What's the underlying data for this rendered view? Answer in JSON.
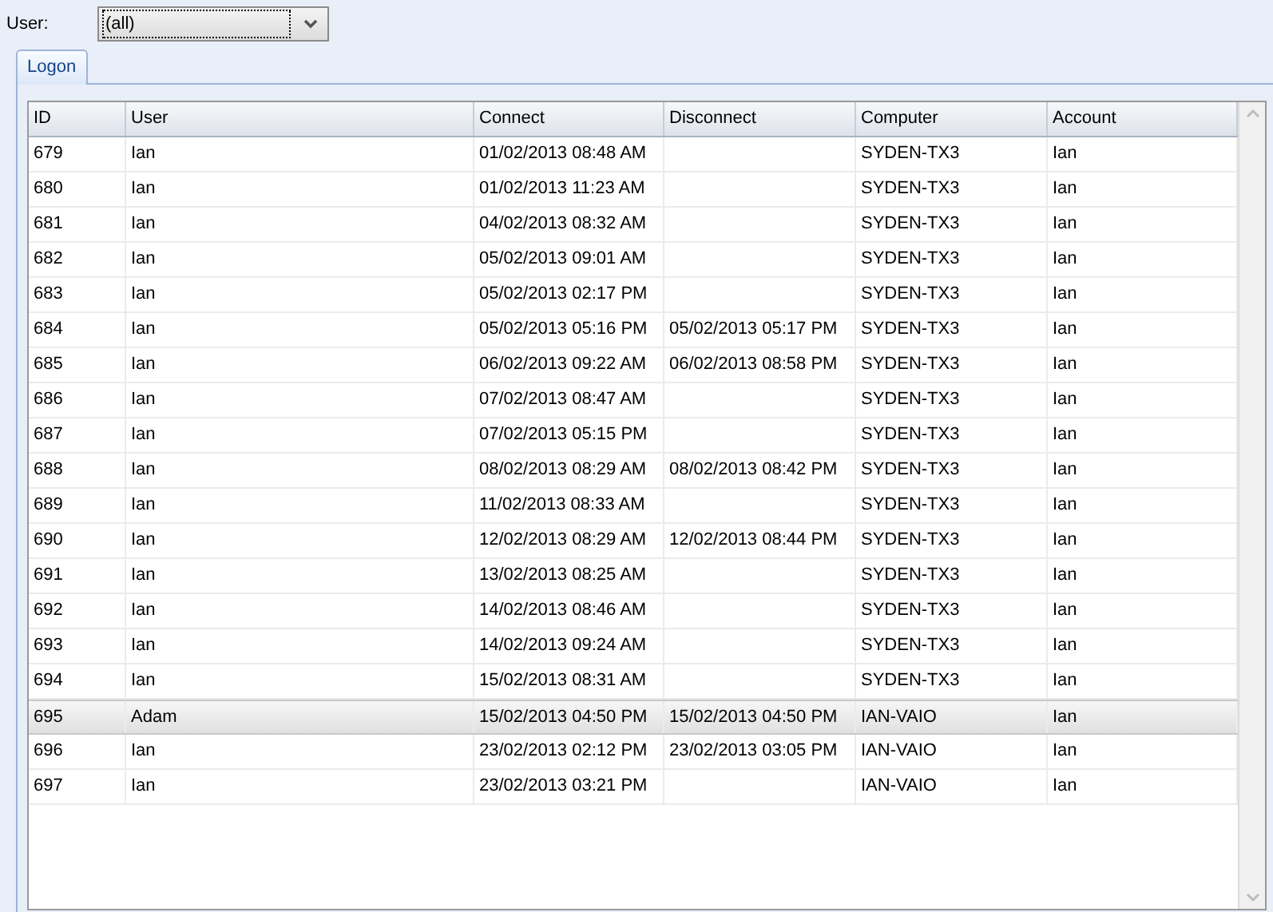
{
  "filter": {
    "label": "User:",
    "value": "(all)"
  },
  "tabs": [
    {
      "label": "Logon",
      "selected": true
    }
  ],
  "table": {
    "columns": [
      "ID",
      "User",
      "Connect",
      "Disconnect",
      "Computer",
      "Account"
    ],
    "rows": [
      {
        "cells": [
          "679",
          "Ian",
          "01/02/2013 08:48 AM",
          "",
          "SYDEN-TX3",
          "Ian"
        ],
        "selected": false
      },
      {
        "cells": [
          "680",
          "Ian",
          "01/02/2013 11:23 AM",
          "",
          "SYDEN-TX3",
          "Ian"
        ],
        "selected": false
      },
      {
        "cells": [
          "681",
          "Ian",
          "04/02/2013 08:32 AM",
          "",
          "SYDEN-TX3",
          "Ian"
        ],
        "selected": false
      },
      {
        "cells": [
          "682",
          "Ian",
          "05/02/2013 09:01 AM",
          "",
          "SYDEN-TX3",
          "Ian"
        ],
        "selected": false
      },
      {
        "cells": [
          "683",
          "Ian",
          "05/02/2013 02:17 PM",
          "",
          "SYDEN-TX3",
          "Ian"
        ],
        "selected": false
      },
      {
        "cells": [
          "684",
          "Ian",
          "05/02/2013 05:16 PM",
          "05/02/2013 05:17 PM",
          "SYDEN-TX3",
          "Ian"
        ],
        "selected": false
      },
      {
        "cells": [
          "685",
          "Ian",
          "06/02/2013 09:22 AM",
          "06/02/2013 08:58 PM",
          "SYDEN-TX3",
          "Ian"
        ],
        "selected": false
      },
      {
        "cells": [
          "686",
          "Ian",
          "07/02/2013 08:47 AM",
          "",
          "SYDEN-TX3",
          "Ian"
        ],
        "selected": false
      },
      {
        "cells": [
          "687",
          "Ian",
          "07/02/2013 05:15 PM",
          "",
          "SYDEN-TX3",
          "Ian"
        ],
        "selected": false
      },
      {
        "cells": [
          "688",
          "Ian",
          "08/02/2013 08:29 AM",
          "08/02/2013 08:42 PM",
          "SYDEN-TX3",
          "Ian"
        ],
        "selected": false
      },
      {
        "cells": [
          "689",
          "Ian",
          "11/02/2013 08:33 AM",
          "",
          "SYDEN-TX3",
          "Ian"
        ],
        "selected": false
      },
      {
        "cells": [
          "690",
          "Ian",
          "12/02/2013 08:29 AM",
          "12/02/2013 08:44 PM",
          "SYDEN-TX3",
          "Ian"
        ],
        "selected": false
      },
      {
        "cells": [
          "691",
          "Ian",
          "13/02/2013 08:25 AM",
          "",
          "SYDEN-TX3",
          "Ian"
        ],
        "selected": false
      },
      {
        "cells": [
          "692",
          "Ian",
          "14/02/2013 08:46 AM",
          "",
          "SYDEN-TX3",
          "Ian"
        ],
        "selected": false
      },
      {
        "cells": [
          "693",
          "Ian",
          "14/02/2013 09:24 AM",
          "",
          "SYDEN-TX3",
          "Ian"
        ],
        "selected": false
      },
      {
        "cells": [
          "694",
          "Ian",
          "15/02/2013 08:31 AM",
          "",
          "SYDEN-TX3",
          "Ian"
        ],
        "selected": false
      },
      {
        "cells": [
          "695",
          "Adam",
          "15/02/2013 04:50 PM",
          "15/02/2013 04:50 PM",
          "IAN-VAIO",
          "Ian"
        ],
        "selected": true
      },
      {
        "cells": [
          "696",
          "Ian",
          "23/02/2013 02:12 PM",
          "23/02/2013 03:05 PM",
          "IAN-VAIO",
          "Ian"
        ],
        "selected": false
      },
      {
        "cells": [
          "697",
          "Ian",
          "23/02/2013 03:21 PM",
          "",
          "IAN-VAIO",
          "Ian"
        ],
        "selected": false
      }
    ]
  }
}
